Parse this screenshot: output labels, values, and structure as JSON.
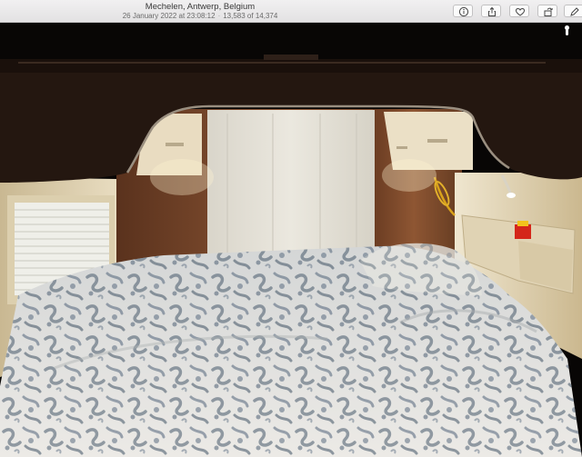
{
  "window": {
    "title": "Mechelen, Antwerp, Belgium",
    "datetime": "26 January 2022 at 23:08:12",
    "counter": "13,583 of 14,374"
  },
  "toolbar": {
    "buttons": [
      {
        "name": "info-button",
        "icon": "info-icon"
      },
      {
        "name": "share-button",
        "icon": "share-icon"
      },
      {
        "name": "favorite-button",
        "icon": "heart-icon"
      },
      {
        "name": "rotate-button",
        "icon": "rotate-icon"
      },
      {
        "name": "edit-button",
        "icon": "edit-icon"
      }
    ]
  },
  "photo": {
    "subject": "camper-van-bedroom",
    "colors": {
      "wood": "#7a4a2c",
      "cabinet_dark": "#2a1a12",
      "curtain": "#e8e4da",
      "duvet_light": "#e6e6e2",
      "duvet_pattern": "#4a5a6a",
      "wall": "#e6d8b8"
    }
  }
}
